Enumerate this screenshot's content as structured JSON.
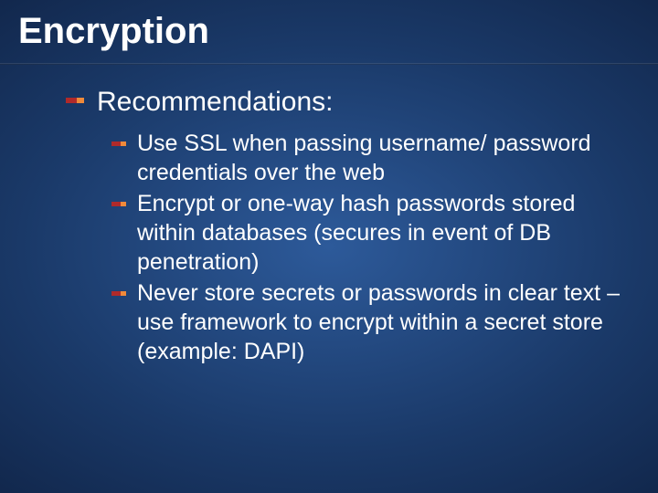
{
  "slide": {
    "title": "Encryption",
    "section_label": "Recommendations:",
    "items": [
      "Use SSL when passing username/ password credentials over the web",
      "Encrypt or one-way hash passwords stored within databases (secures in event of DB penetration)",
      "Never store secrets or passwords in clear text – use framework to encrypt within a secret store (example: DAPI)"
    ]
  }
}
